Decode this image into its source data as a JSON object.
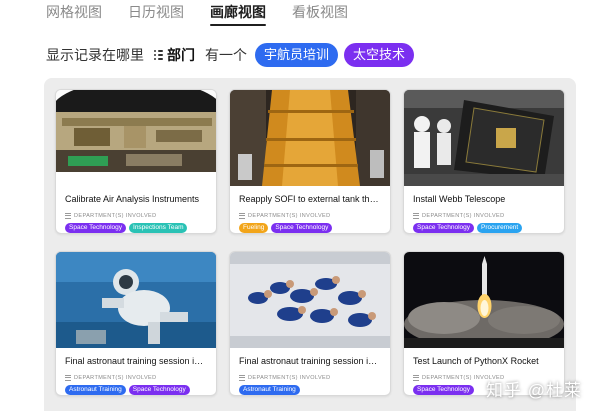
{
  "views": [
    {
      "label": "网格视图",
      "active": false
    },
    {
      "label": "日历视图",
      "active": false
    },
    {
      "label": "画廊视图",
      "active": true
    },
    {
      "label": "看板视图",
      "active": false
    }
  ],
  "filter": {
    "prefix": "显示记录在哪里",
    "field": "部门",
    "operator": "有一个",
    "values": [
      {
        "label": "宇航员培训",
        "color": "#2e6bf0"
      },
      {
        "label": "太空技术",
        "color": "#7b2ff0"
      }
    ]
  },
  "field_label": "DEPARTMENT(S) INVOLVED",
  "cards": [
    {
      "title": "Calibrate Air Analysis Instruments",
      "image": "lab-instrument-image",
      "tags": [
        {
          "label": "Space Technology",
          "color": "purple"
        },
        {
          "label": "Inspections Team",
          "color": "teal"
        }
      ]
    },
    {
      "title": "Reapply SOFI to external tank therm...",
      "image": "external-tank-image",
      "tags": [
        {
          "label": "Fueling",
          "color": "orange"
        },
        {
          "label": "Space Technology",
          "color": "purple"
        }
      ]
    },
    {
      "title": "Install Webb Telescope",
      "image": "webb-telescope-image",
      "tags": [
        {
          "label": "Space Technology",
          "color": "purple"
        },
        {
          "label": "Procurement",
          "color": "sky"
        }
      ]
    },
    {
      "title": "Final astronaut training session in ne...",
      "image": "underwater-training-image",
      "tags": [
        {
          "label": "Astronaut Training",
          "color": "blue"
        },
        {
          "label": "Space Technology",
          "color": "purple"
        }
      ]
    },
    {
      "title": "Final astronaut training session in K...",
      "image": "zero-gravity-image",
      "tags": [
        {
          "label": "Astronaut Training",
          "color": "blue"
        }
      ]
    },
    {
      "title": "Test Launch of PythonX Rocket",
      "image": "rocket-launch-image",
      "tags": [
        {
          "label": "Space Technology",
          "color": "purple"
        }
      ]
    }
  ],
  "watermark": "知乎 @杜莱"
}
